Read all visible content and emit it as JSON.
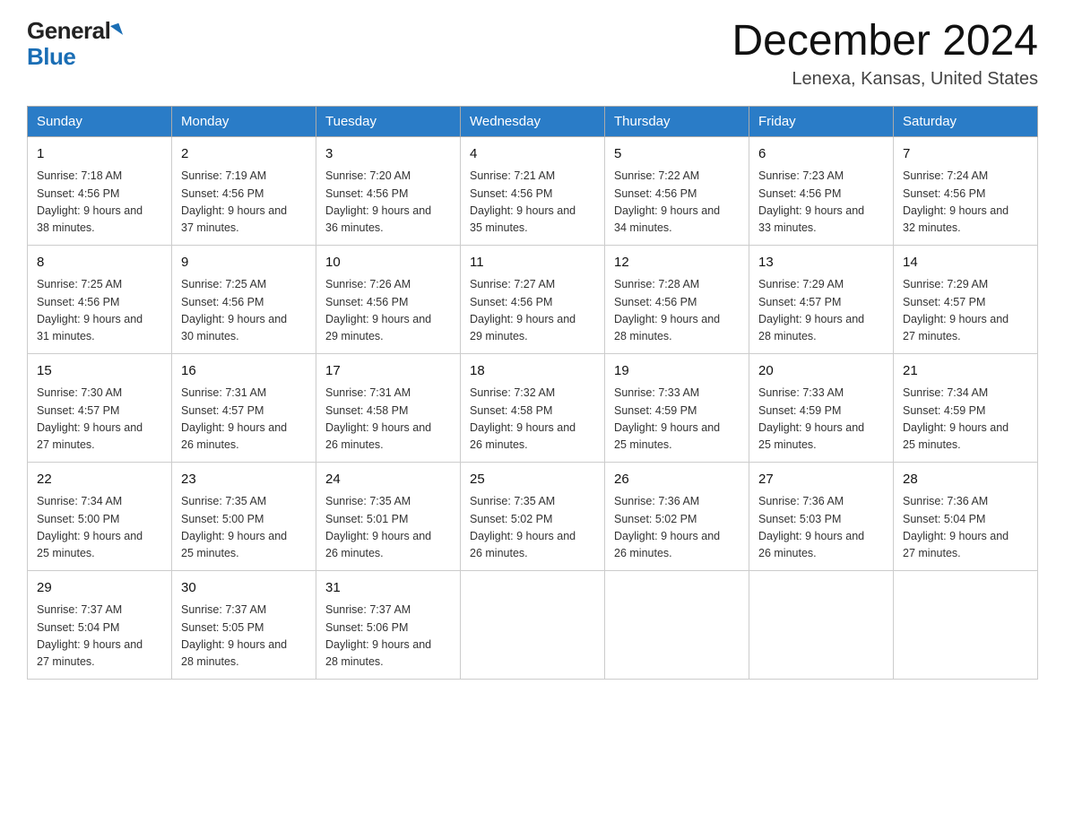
{
  "logo": {
    "general": "General",
    "blue": "Blue"
  },
  "title": {
    "month": "December 2024",
    "location": "Lenexa, Kansas, United States"
  },
  "days_of_week": [
    "Sunday",
    "Monday",
    "Tuesday",
    "Wednesday",
    "Thursday",
    "Friday",
    "Saturday"
  ],
  "weeks": [
    [
      {
        "day": "1",
        "sunrise": "7:18 AM",
        "sunset": "4:56 PM",
        "daylight": "9 hours and 38 minutes."
      },
      {
        "day": "2",
        "sunrise": "7:19 AM",
        "sunset": "4:56 PM",
        "daylight": "9 hours and 37 minutes."
      },
      {
        "day": "3",
        "sunrise": "7:20 AM",
        "sunset": "4:56 PM",
        "daylight": "9 hours and 36 minutes."
      },
      {
        "day": "4",
        "sunrise": "7:21 AM",
        "sunset": "4:56 PM",
        "daylight": "9 hours and 35 minutes."
      },
      {
        "day": "5",
        "sunrise": "7:22 AM",
        "sunset": "4:56 PM",
        "daylight": "9 hours and 34 minutes."
      },
      {
        "day": "6",
        "sunrise": "7:23 AM",
        "sunset": "4:56 PM",
        "daylight": "9 hours and 33 minutes."
      },
      {
        "day": "7",
        "sunrise": "7:24 AM",
        "sunset": "4:56 PM",
        "daylight": "9 hours and 32 minutes."
      }
    ],
    [
      {
        "day": "8",
        "sunrise": "7:25 AM",
        "sunset": "4:56 PM",
        "daylight": "9 hours and 31 minutes."
      },
      {
        "day": "9",
        "sunrise": "7:25 AM",
        "sunset": "4:56 PM",
        "daylight": "9 hours and 30 minutes."
      },
      {
        "day": "10",
        "sunrise": "7:26 AM",
        "sunset": "4:56 PM",
        "daylight": "9 hours and 29 minutes."
      },
      {
        "day": "11",
        "sunrise": "7:27 AM",
        "sunset": "4:56 PM",
        "daylight": "9 hours and 29 minutes."
      },
      {
        "day": "12",
        "sunrise": "7:28 AM",
        "sunset": "4:56 PM",
        "daylight": "9 hours and 28 minutes."
      },
      {
        "day": "13",
        "sunrise": "7:29 AM",
        "sunset": "4:57 PM",
        "daylight": "9 hours and 28 minutes."
      },
      {
        "day": "14",
        "sunrise": "7:29 AM",
        "sunset": "4:57 PM",
        "daylight": "9 hours and 27 minutes."
      }
    ],
    [
      {
        "day": "15",
        "sunrise": "7:30 AM",
        "sunset": "4:57 PM",
        "daylight": "9 hours and 27 minutes."
      },
      {
        "day": "16",
        "sunrise": "7:31 AM",
        "sunset": "4:57 PM",
        "daylight": "9 hours and 26 minutes."
      },
      {
        "day": "17",
        "sunrise": "7:31 AM",
        "sunset": "4:58 PM",
        "daylight": "9 hours and 26 minutes."
      },
      {
        "day": "18",
        "sunrise": "7:32 AM",
        "sunset": "4:58 PM",
        "daylight": "9 hours and 26 minutes."
      },
      {
        "day": "19",
        "sunrise": "7:33 AM",
        "sunset": "4:59 PM",
        "daylight": "9 hours and 25 minutes."
      },
      {
        "day": "20",
        "sunrise": "7:33 AM",
        "sunset": "4:59 PM",
        "daylight": "9 hours and 25 minutes."
      },
      {
        "day": "21",
        "sunrise": "7:34 AM",
        "sunset": "4:59 PM",
        "daylight": "9 hours and 25 minutes."
      }
    ],
    [
      {
        "day": "22",
        "sunrise": "7:34 AM",
        "sunset": "5:00 PM",
        "daylight": "9 hours and 25 minutes."
      },
      {
        "day": "23",
        "sunrise": "7:35 AM",
        "sunset": "5:00 PM",
        "daylight": "9 hours and 25 minutes."
      },
      {
        "day": "24",
        "sunrise": "7:35 AM",
        "sunset": "5:01 PM",
        "daylight": "9 hours and 26 minutes."
      },
      {
        "day": "25",
        "sunrise": "7:35 AM",
        "sunset": "5:02 PM",
        "daylight": "9 hours and 26 minutes."
      },
      {
        "day": "26",
        "sunrise": "7:36 AM",
        "sunset": "5:02 PM",
        "daylight": "9 hours and 26 minutes."
      },
      {
        "day": "27",
        "sunrise": "7:36 AM",
        "sunset": "5:03 PM",
        "daylight": "9 hours and 26 minutes."
      },
      {
        "day": "28",
        "sunrise": "7:36 AM",
        "sunset": "5:04 PM",
        "daylight": "9 hours and 27 minutes."
      }
    ],
    [
      {
        "day": "29",
        "sunrise": "7:37 AM",
        "sunset": "5:04 PM",
        "daylight": "9 hours and 27 minutes."
      },
      {
        "day": "30",
        "sunrise": "7:37 AM",
        "sunset": "5:05 PM",
        "daylight": "9 hours and 28 minutes."
      },
      {
        "day": "31",
        "sunrise": "7:37 AM",
        "sunset": "5:06 PM",
        "daylight": "9 hours and 28 minutes."
      },
      null,
      null,
      null,
      null
    ]
  ],
  "labels": {
    "sunrise": "Sunrise: ",
    "sunset": "Sunset: ",
    "daylight": "Daylight: "
  }
}
